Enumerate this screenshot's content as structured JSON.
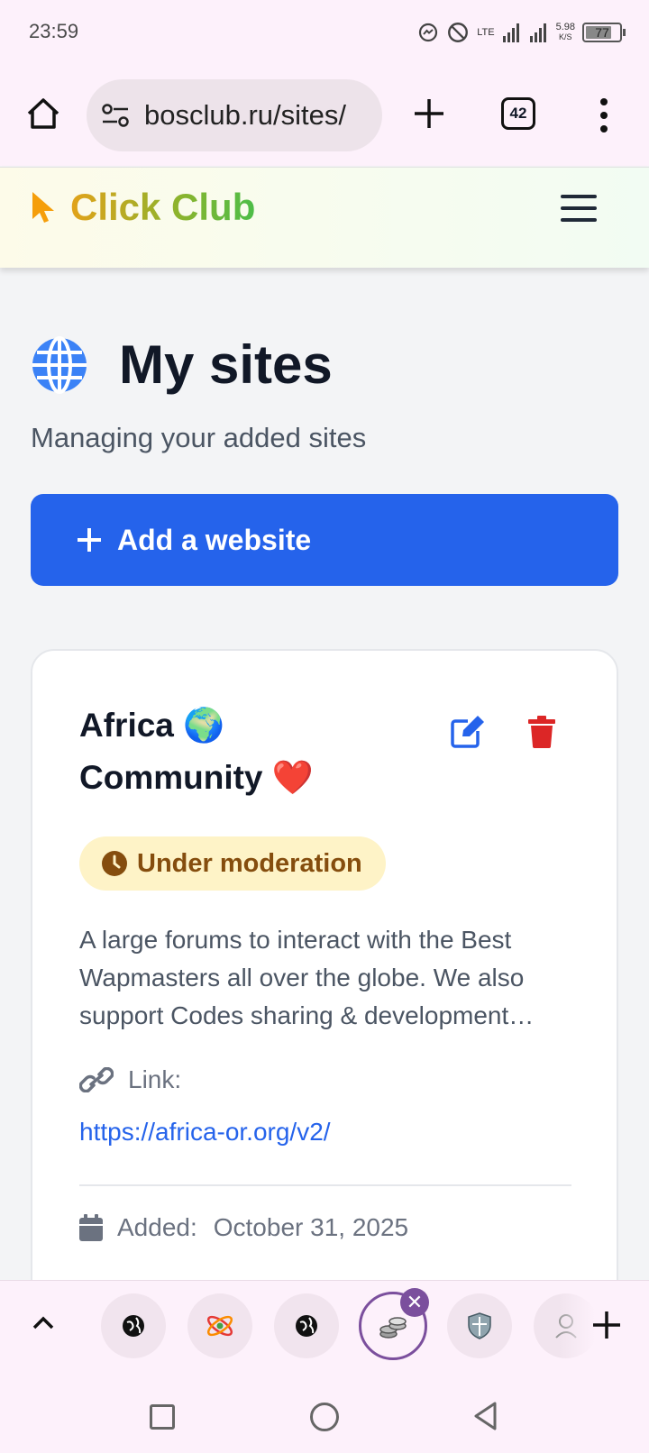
{
  "status": {
    "time": "23:59",
    "network": "LTE",
    "speed_value": "5.98",
    "speed_unit": "K/S",
    "battery": "77"
  },
  "browser": {
    "url": "bosclub.ru/sites/",
    "tab_count": "42"
  },
  "site": {
    "brand": "Click Club"
  },
  "page": {
    "title": "My sites",
    "subtitle": "Managing your added sites",
    "add_button": "Add a website"
  },
  "site_card": {
    "title_line1": "Africa 🌍",
    "title_line2": "Community ❤️",
    "status": "Under moderation",
    "description": "A large forums to interact with the Best Wapmasters all over the globe. We also support Codes sharing & development…",
    "link_label": "Link:",
    "link_url": "https://africa-or.org/v2/",
    "added_label": "Added:",
    "added_date": "October 31, 2025"
  },
  "colors": {
    "accent": "#2563eb",
    "danger": "#dc2626",
    "badge_bg": "#fef3c7",
    "badge_text": "#854d0e",
    "brand_start": "#e2a21a",
    "brand_end": "#4cbd48"
  },
  "tabs": [
    {
      "icon": "globe-icon"
    },
    {
      "icon": "heart-atom-icon"
    },
    {
      "icon": "globe-icon"
    },
    {
      "icon": "coins-icon",
      "active": true
    },
    {
      "icon": "shield-icon"
    },
    {
      "icon": "avatar-icon"
    }
  ]
}
